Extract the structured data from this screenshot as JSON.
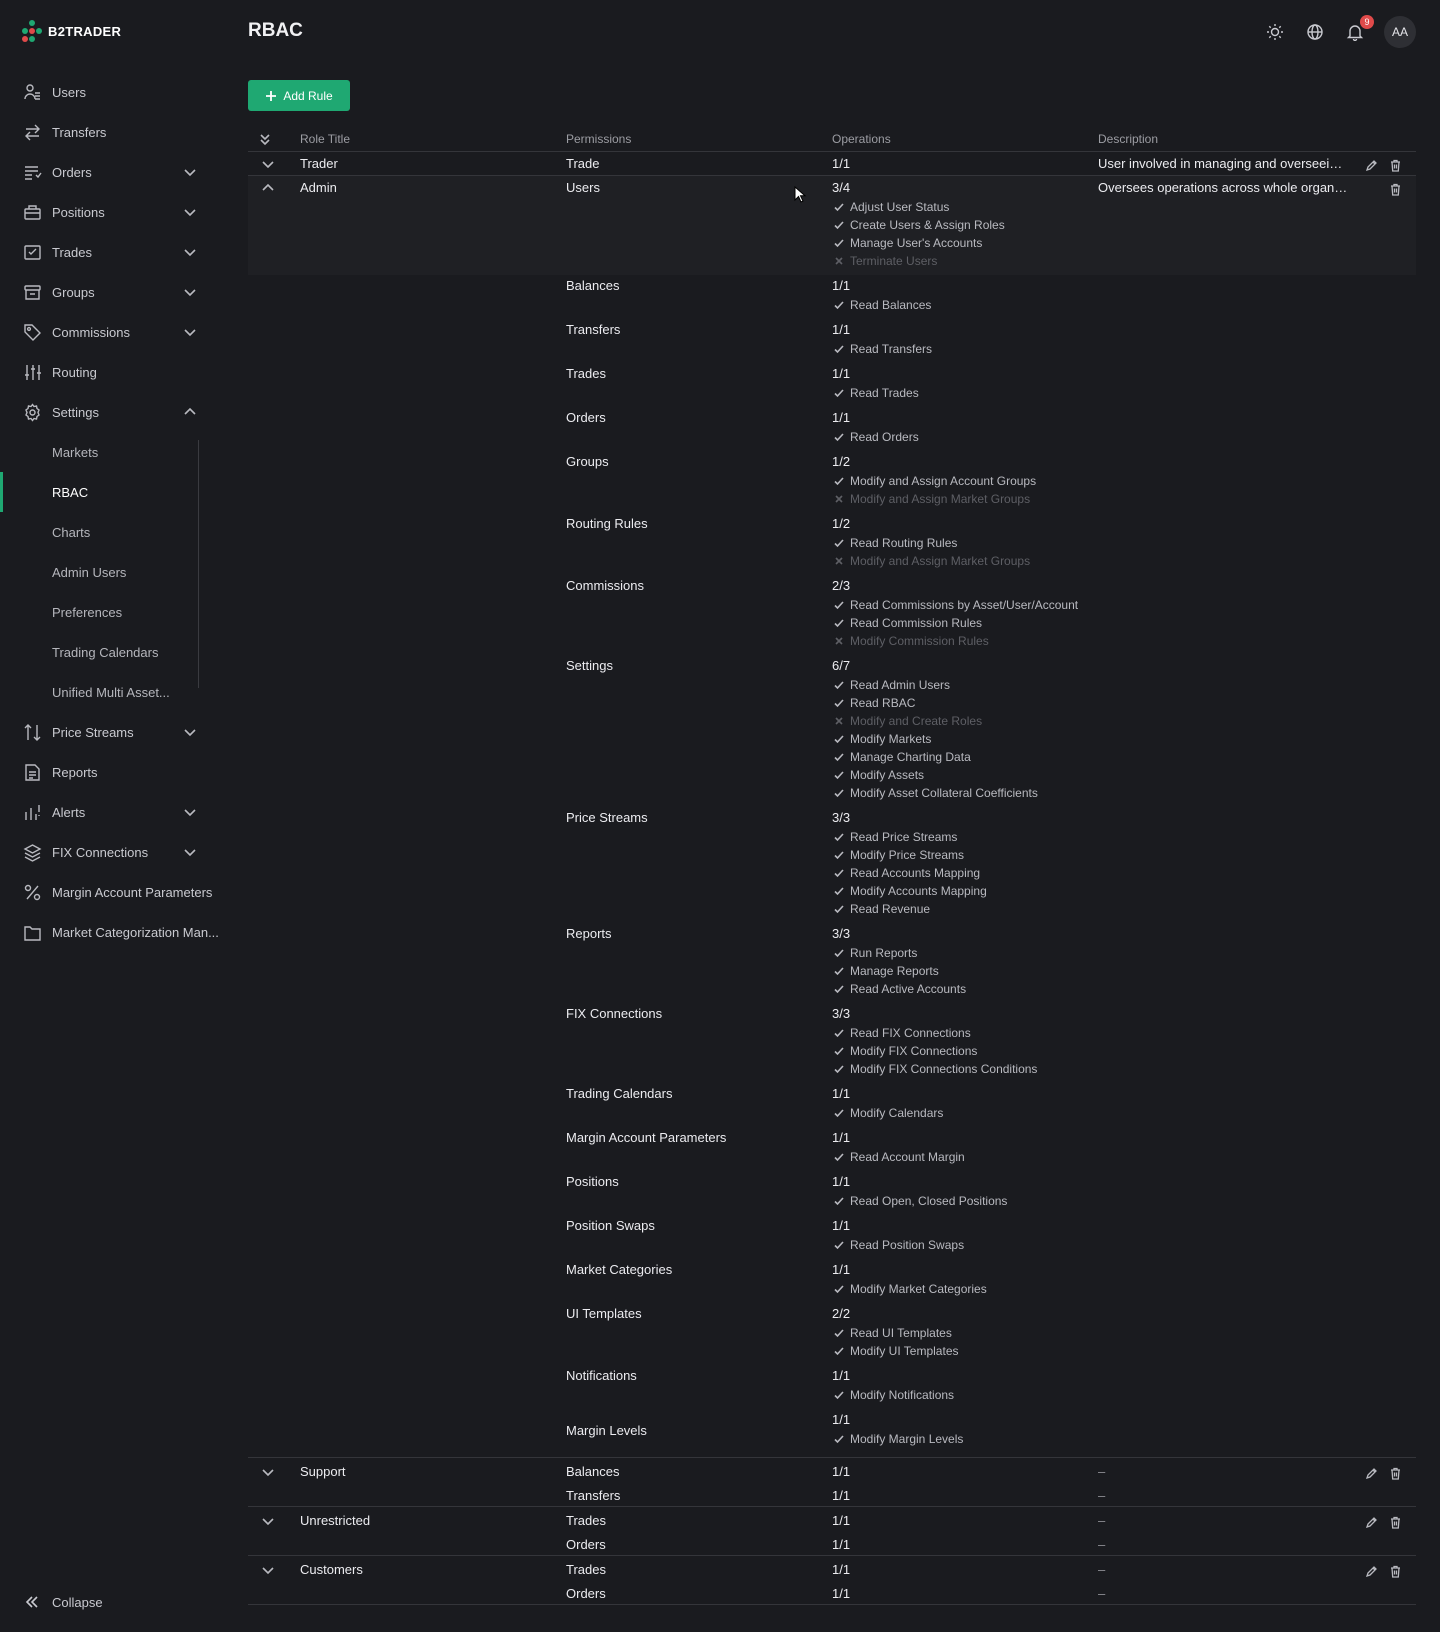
{
  "app": {
    "brand": "B2TRADER",
    "page_title": "RBAC",
    "notifications_count": "9",
    "avatar_initials": "AA",
    "colors": {
      "accent": "#1fa872",
      "badge": "#e04a4a",
      "background": "#1a1b1f"
    }
  },
  "sidebar": {
    "items": [
      {
        "label": "Users",
        "icon": "users-icon",
        "expandable": false
      },
      {
        "label": "Transfers",
        "icon": "arrows-icon",
        "expandable": false
      },
      {
        "label": "Orders",
        "icon": "orders-icon",
        "expandable": true
      },
      {
        "label": "Positions",
        "icon": "briefcase-icon",
        "expandable": true
      },
      {
        "label": "Trades",
        "icon": "checklist-icon",
        "expandable": true
      },
      {
        "label": "Groups",
        "icon": "archive-icon",
        "expandable": true
      },
      {
        "label": "Commissions",
        "icon": "tag-icon",
        "expandable": true
      },
      {
        "label": "Routing",
        "icon": "sliders-icon",
        "expandable": false
      },
      {
        "label": "Settings",
        "icon": "gear-icon",
        "expandable": true
      }
    ],
    "settings_sub": [
      {
        "label": "Markets"
      },
      {
        "label": "RBAC"
      },
      {
        "label": "Charts"
      },
      {
        "label": "Admin Users"
      },
      {
        "label": "Preferences"
      },
      {
        "label": "Trading Calendars"
      },
      {
        "label": "Unified Multi Asset..."
      }
    ],
    "items_after": [
      {
        "label": "Price Streams",
        "icon": "sort-arrows-icon",
        "expandable": true
      },
      {
        "label": "Reports",
        "icon": "document-icon",
        "expandable": false
      },
      {
        "label": "Alerts",
        "icon": "alert-chart-icon",
        "expandable": true
      },
      {
        "label": "FIX Connections",
        "icon": "layers-icon",
        "expandable": true
      },
      {
        "label": "Margin Account Parameters",
        "icon": "percent-icon",
        "expandable": false
      },
      {
        "label": "Market Categorization Man...",
        "icon": "folder-icon",
        "expandable": false
      }
    ],
    "collapse_label": "Collapse"
  },
  "toolbar": {
    "add_rule_label": "Add Rule"
  },
  "table": {
    "headers": {
      "role_title": "Role Title",
      "permissions": "Permissions",
      "operations": "Operations",
      "description": "Description"
    },
    "trader": {
      "title": "Trader",
      "permission": "Trade",
      "ops": "1/1",
      "description": "User involved in managing and overseeing..."
    },
    "admin": {
      "title": "Admin",
      "description": "Oversees operations across whole organiz...",
      "permissions": [
        {
          "name": "Users",
          "ops": "3/4",
          "lines": [
            {
              "t": "Adjust User Status",
              "on": true
            },
            {
              "t": "Create Users & Assign Roles",
              "on": true
            },
            {
              "t": "Manage User's Accounts",
              "on": true
            },
            {
              "t": "Terminate Users",
              "on": false
            }
          ]
        },
        {
          "name": "Balances",
          "ops": "1/1",
          "lines": [
            {
              "t": "Read Balances",
              "on": true
            }
          ]
        },
        {
          "name": "Transfers",
          "ops": "1/1",
          "lines": [
            {
              "t": "Read Transfers",
              "on": true
            }
          ]
        },
        {
          "name": "Trades",
          "ops": "1/1",
          "lines": [
            {
              "t": "Read Trades",
              "on": true
            }
          ]
        },
        {
          "name": "Orders",
          "ops": "1/1",
          "lines": [
            {
              "t": "Read Orders",
              "on": true
            }
          ]
        },
        {
          "name": "Groups",
          "ops": "1/2",
          "lines": [
            {
              "t": "Modify and Assign Account Groups",
              "on": true
            },
            {
              "t": "Modify and Assign Market Groups",
              "on": false
            }
          ]
        },
        {
          "name": "Routing Rules",
          "ops": "1/2",
          "lines": [
            {
              "t": "Read Routing Rules",
              "on": true
            },
            {
              "t": "Modify and Assign Market Groups",
              "on": false
            }
          ]
        },
        {
          "name": "Commissions",
          "ops": "2/3",
          "lines": [
            {
              "t": "Read Commissions by Asset/User/Account",
              "on": true
            },
            {
              "t": "Read Commission Rules",
              "on": true
            },
            {
              "t": "Modify Commission Rules",
              "on": false
            }
          ]
        },
        {
          "name": "Settings",
          "ops": "6/7",
          "lines": [
            {
              "t": "Read Admin Users",
              "on": true
            },
            {
              "t": "Read RBAC",
              "on": true
            },
            {
              "t": "Modify and Create Roles",
              "on": false
            },
            {
              "t": "Modify Markets",
              "on": true
            },
            {
              "t": "Manage Charting Data",
              "on": true
            },
            {
              "t": "Modify Assets",
              "on": true
            },
            {
              "t": "Modify Asset Collateral Coefficients",
              "on": true
            }
          ]
        },
        {
          "name": "Price Streams",
          "ops": "3/3",
          "lines": [
            {
              "t": "Read Price Streams",
              "on": true
            },
            {
              "t": "Modify Price Streams",
              "on": true
            },
            {
              "t": "Read Accounts Mapping",
              "on": true
            },
            {
              "t": "Modify Accounts Mapping",
              "on": true
            },
            {
              "t": "Read Revenue",
              "on": true
            }
          ]
        },
        {
          "name": "Reports",
          "ops": "3/3",
          "lines": [
            {
              "t": "Run Reports",
              "on": true
            },
            {
              "t": "Manage Reports",
              "on": true
            },
            {
              "t": "Read Active Accounts",
              "on": true
            }
          ]
        },
        {
          "name": "FIX Connections",
          "ops": "3/3",
          "lines": [
            {
              "t": "Read FIX Connections",
              "on": true
            },
            {
              "t": "Modify FIX Connections",
              "on": true
            },
            {
              "t": "Modify FIX Connections Conditions",
              "on": true
            }
          ]
        },
        {
          "name": "Trading Calendars",
          "ops": "1/1",
          "lines": [
            {
              "t": "Modify Calendars",
              "on": true
            }
          ]
        },
        {
          "name": "Margin Account Parameters",
          "ops": "1/1",
          "lines": [
            {
              "t": "Read Account Margin",
              "on": true
            }
          ]
        },
        {
          "name": "Positions",
          "ops": "1/1",
          "lines": [
            {
              "t": "Read Open, Closed Positions",
              "on": true
            }
          ]
        },
        {
          "name": "Position Swaps",
          "ops": "1/1",
          "lines": [
            {
              "t": "Read Position Swaps",
              "on": true
            }
          ]
        },
        {
          "name": "Market Categories",
          "ops": "1/1",
          "lines": [
            {
              "t": "Modify Market Categories",
              "on": true
            }
          ]
        },
        {
          "name": "UI Templates",
          "ops": "2/2",
          "lines": [
            {
              "t": "Read UI Templates",
              "on": true
            },
            {
              "t": "Modify UI Templates",
              "on": true
            }
          ]
        },
        {
          "name": "Notifications",
          "ops": "1/1",
          "lines": [
            {
              "t": "Modify Notifications",
              "on": true
            }
          ]
        },
        {
          "name": "Margin Levels",
          "ops": "1/1",
          "lines": [
            {
              "t": "Modify Margin Levels",
              "on": true
            }
          ]
        }
      ]
    },
    "other_roles": [
      {
        "title": "Support",
        "rows": [
          {
            "perm": "Balances",
            "ops": "1/1",
            "desc": "–"
          },
          {
            "perm": "Transfers",
            "ops": "1/1",
            "desc": "–"
          }
        ]
      },
      {
        "title": "Unrestricted",
        "rows": [
          {
            "perm": "Trades",
            "ops": "1/1",
            "desc": "–"
          },
          {
            "perm": "Orders",
            "ops": "1/1",
            "desc": "–"
          }
        ]
      },
      {
        "title": "Customers",
        "rows": [
          {
            "perm": "Trades",
            "ops": "1/1",
            "desc": "–"
          },
          {
            "perm": "Orders",
            "ops": "1/1",
            "desc": "–"
          }
        ]
      }
    ]
  }
}
